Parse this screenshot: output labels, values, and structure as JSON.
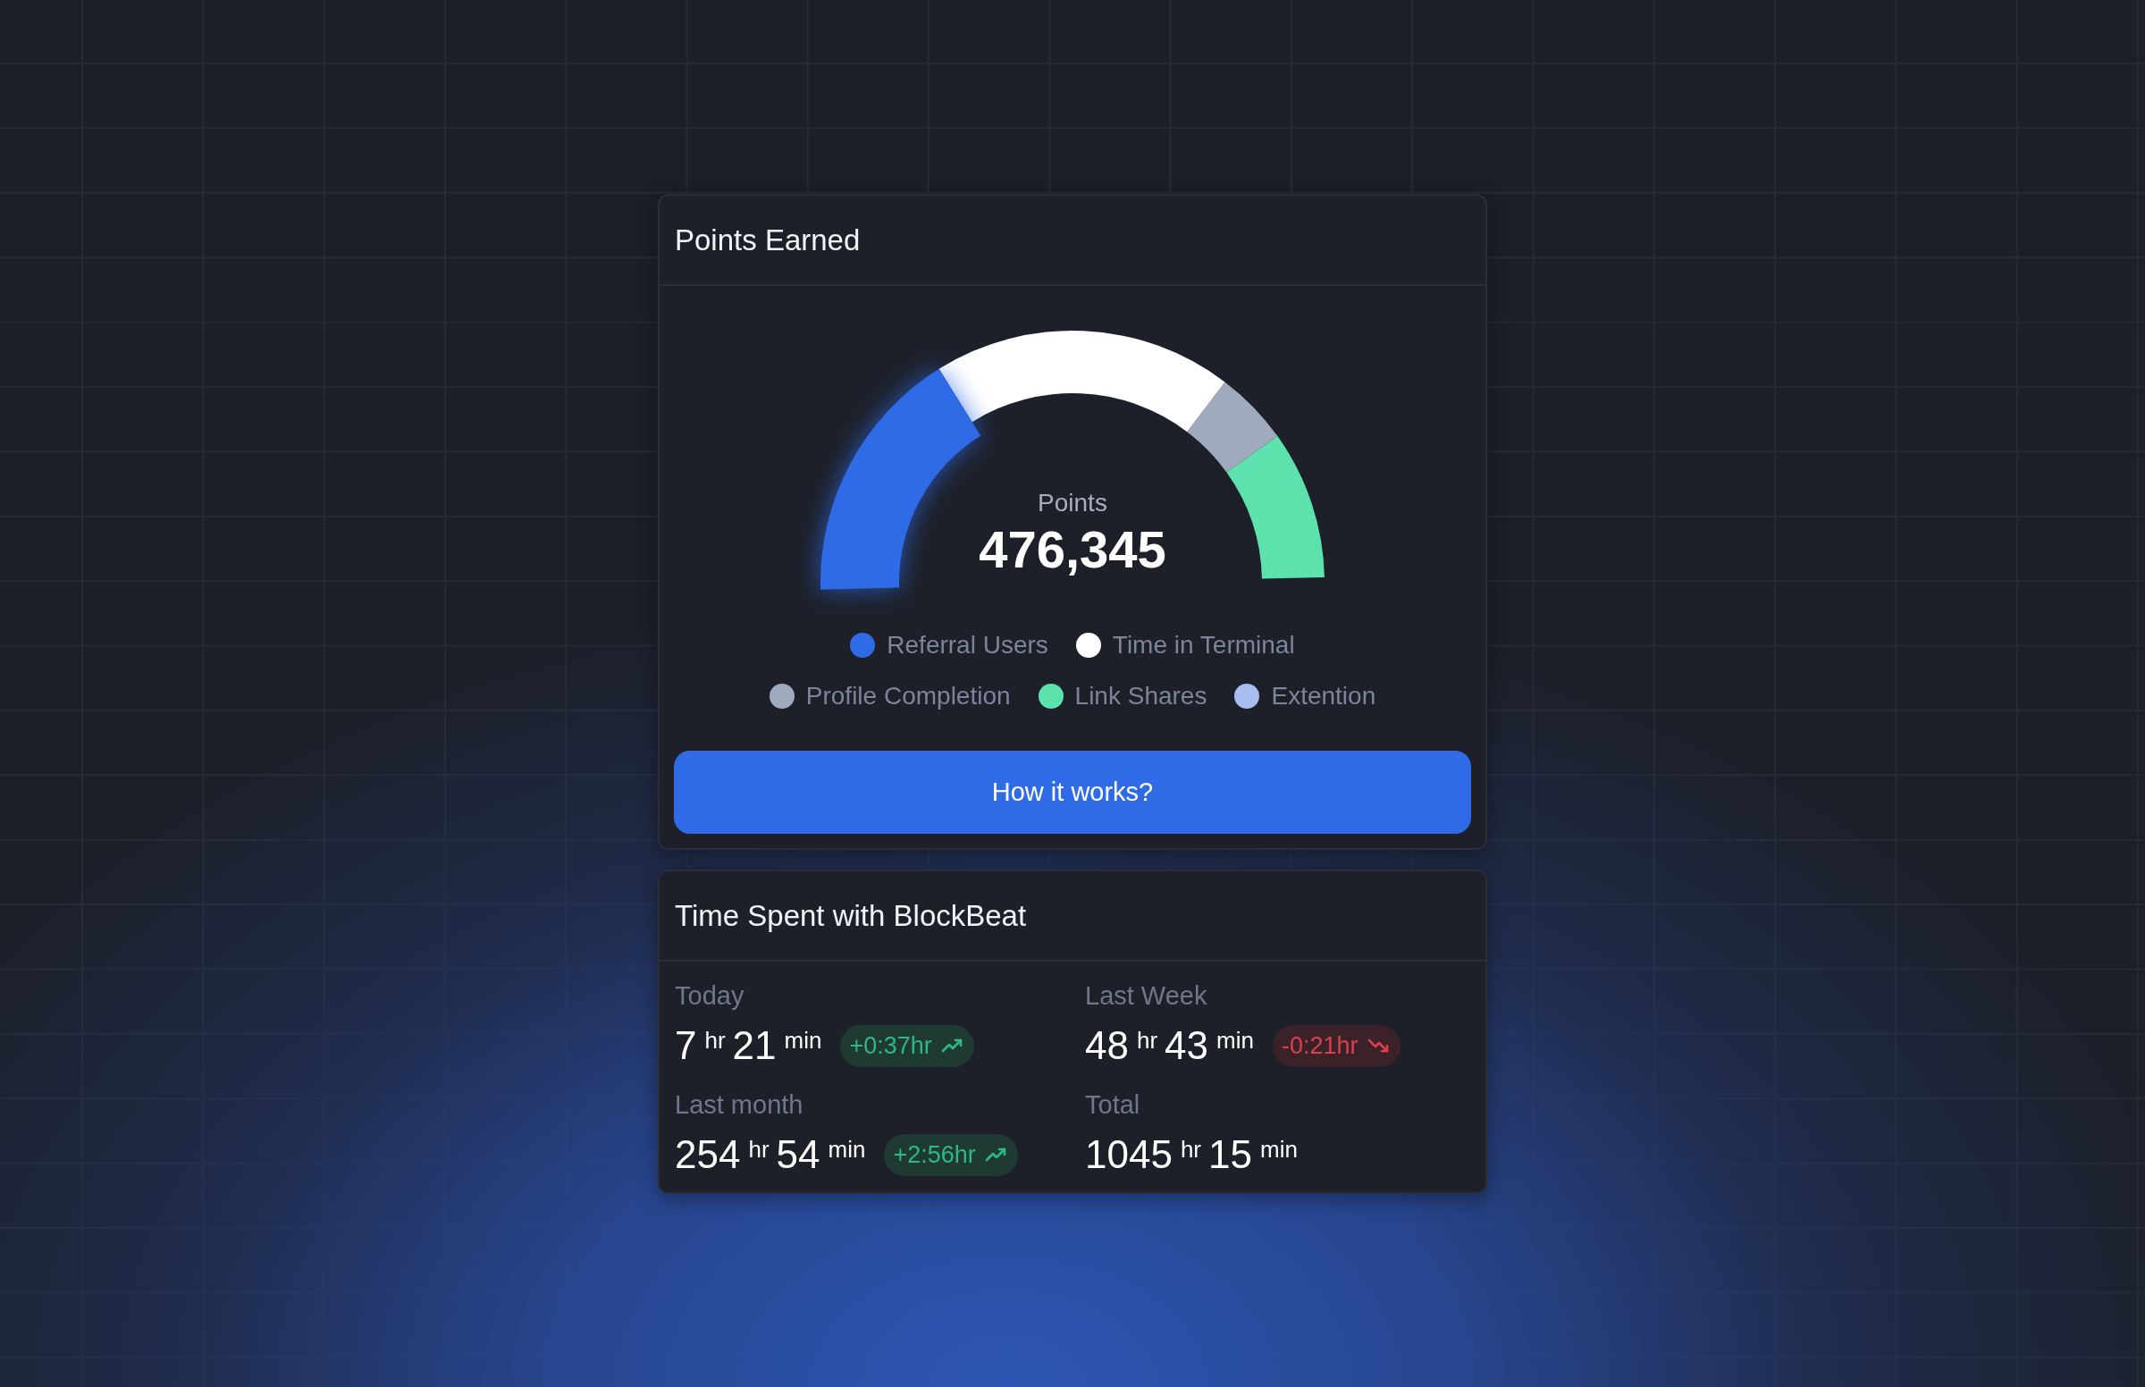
{
  "points_card": {
    "title": "Points Earned",
    "gauge": {
      "label": "Points",
      "value": "476,345"
    },
    "legend": [
      [
        {
          "label": "Referral Users",
          "color": "#2f6be6"
        },
        {
          "label": "Time in Terminal",
          "color": "#ffffff"
        }
      ],
      [
        {
          "label": "Profile Completion",
          "color": "#a0aabd"
        },
        {
          "label": "Link Shares",
          "color": "#5de2ad"
        },
        {
          "label": "Extention",
          "color": "#a8bef0"
        }
      ]
    ],
    "button": "How it works?"
  },
  "time_card": {
    "title": "Time Spent with BlockBeat",
    "stats": [
      {
        "label": "Today",
        "hours": "7",
        "hours_unit": "hr",
        "minutes": "21",
        "minutes_unit": "min",
        "change": {
          "text": "+0:37hr",
          "kind": "up"
        }
      },
      {
        "label": "Last Week",
        "hours": "48",
        "hours_unit": "hr",
        "minutes": "43",
        "minutes_unit": "min",
        "change": {
          "text": "-0:21hr",
          "kind": "down"
        }
      },
      {
        "label": "Last month",
        "hours": "254",
        "hours_unit": "hr",
        "minutes": "54",
        "minutes_unit": "min",
        "change": {
          "text": "+2:56hr",
          "kind": "up"
        }
      },
      {
        "label": "Total",
        "hours": "1045",
        "hours_unit": "hr",
        "minutes": "15",
        "minutes_unit": "min"
      }
    ]
  }
}
